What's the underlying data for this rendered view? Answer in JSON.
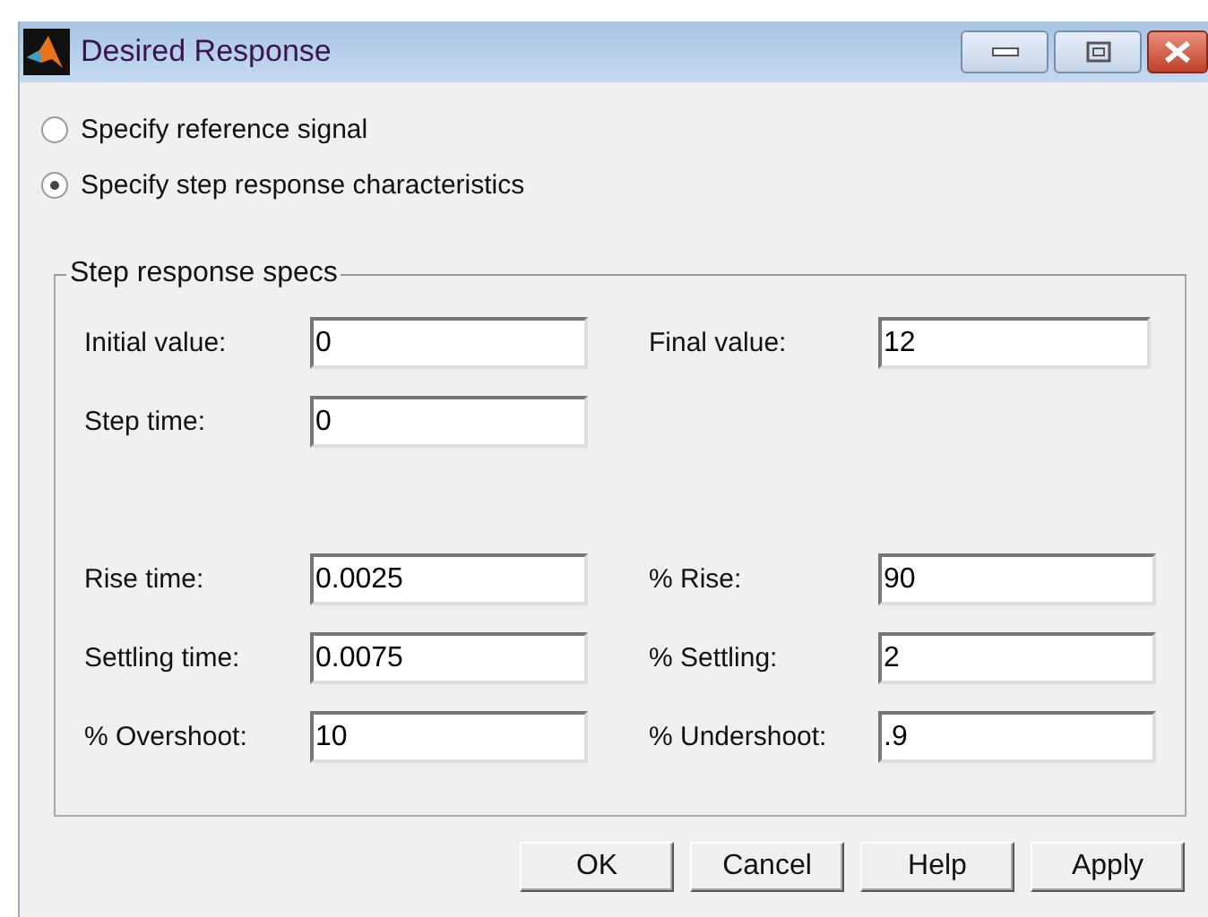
{
  "window": {
    "title": "Desired Response"
  },
  "options": [
    {
      "label": "Specify reference signal",
      "selected": false
    },
    {
      "label": "Specify step response characteristics",
      "selected": true
    }
  ],
  "group": {
    "title": "Step response specs",
    "rows": [
      {
        "left": {
          "label": "Initial value:",
          "value": "0"
        },
        "right": {
          "label": "Final value:",
          "value": "12"
        }
      },
      {
        "left": {
          "label": "Step time:",
          "value": "0"
        }
      },
      {
        "left": {
          "label": "Rise time:",
          "value": "0.0025"
        },
        "right": {
          "label": "% Rise:",
          "value": "90"
        }
      },
      {
        "left": {
          "label": "Settling time:",
          "value": "0.0075"
        },
        "right": {
          "label": "% Settling:",
          "value": "2"
        }
      },
      {
        "left": {
          "label": "% Overshoot:",
          "value": "10"
        },
        "right": {
          "label": "% Undershoot:",
          "value": ".9"
        }
      }
    ]
  },
  "buttons": [
    "OK",
    "Cancel",
    "Help",
    "Apply"
  ]
}
